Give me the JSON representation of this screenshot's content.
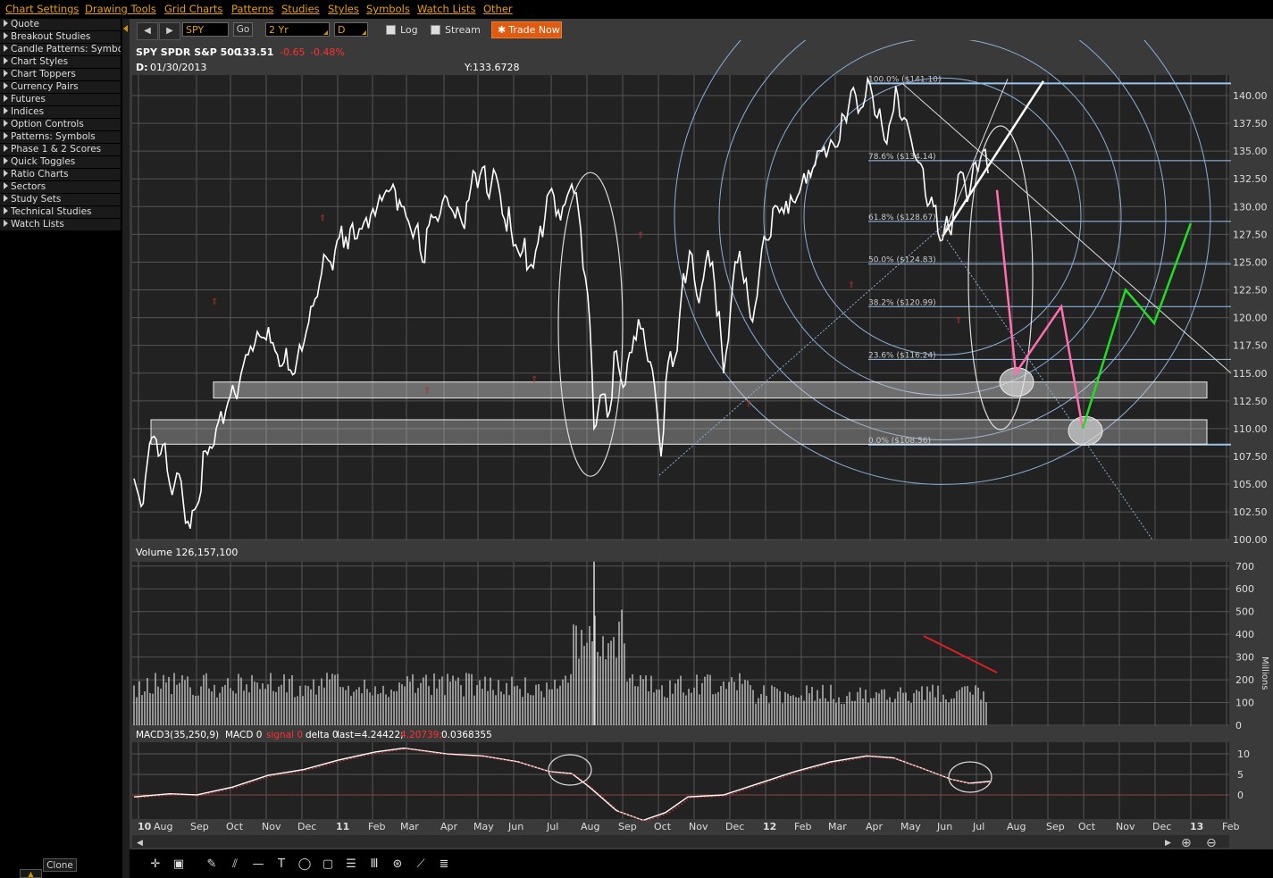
{
  "menu": [
    "Chart Settings",
    "Drawing Tools",
    "Grid Charts",
    "Patterns",
    "Studies",
    "Styles",
    "Symbols",
    "Watch Lists",
    "Other"
  ],
  "sidebar": [
    "Quote",
    "Breakout Studies",
    "Candle Patterns: Symbols",
    "Chart Styles",
    "Chart Toppers",
    "Currency Pairs",
    "Futures",
    "Indices",
    "Option Controls",
    "Patterns: Symbols",
    "Phase 1 & 2 Scores",
    "Quick Toggles",
    "Ratio Charts",
    "Sectors",
    "Study Sets",
    "Technical Studies",
    "Watch Lists"
  ],
  "toolbar": {
    "nav_back": "◀",
    "nav_fwd": "▶",
    "symbol": "SPY",
    "go": "Go",
    "period": "2 Yr",
    "interval": "D",
    "log": "Log",
    "stream": "Stream",
    "trade_now": "Trade Now"
  },
  "header": {
    "title": "SPY SPDR S&P 500",
    "price": "133.51",
    "change": "-0.65",
    "change_pct": "-0.48%",
    "date_label": "D:",
    "date": "01/30/2013",
    "y_label": "Y:133.6728"
  },
  "volume_header": "Volume 126,157,100",
  "macd_header": {
    "name": "MACD3(35,250,9)",
    "macd": "MACD 0",
    "signal": "signal 0",
    "delta": "delta 0",
    "last": "last=4.24422;",
    "last_red": "4.20739;",
    "last_val": "0.0368355"
  },
  "fib_labels": [
    "100.0% ($141.10)",
    "78.6% ($134.14)",
    "61.8% ($128.67)",
    "50.0% ($124.83)",
    "38.2% ($120.99)",
    "23.6% ($116.24)",
    "0.0% ($108.56)"
  ],
  "price_ticks": [
    "140.00",
    "137.50",
    "135.00",
    "132.50",
    "130.00",
    "127.50",
    "125.00",
    "122.50",
    "120.00",
    "117.50",
    "115.00",
    "112.50",
    "110.00",
    "107.50",
    "105.00",
    "102.50",
    "100.00"
  ],
  "volume_ticks": [
    "700",
    "600",
    "500",
    "400",
    "300",
    "200",
    "100",
    "0"
  ],
  "volume_unit": "Millions",
  "macd_ticks": [
    "10",
    "5",
    "0"
  ],
  "x_labels": [
    "10",
    "Aug",
    "Sep",
    "Oct",
    "Nov",
    "Dec",
    "11",
    "Feb",
    "Mar",
    "Apr",
    "May",
    "Jun",
    "Jul",
    "Aug",
    "Sep",
    "Oct",
    "Nov",
    "Dec",
    "12",
    "Feb",
    "Mar",
    "Apr",
    "May",
    "Jun",
    "Jul",
    "Aug",
    "Sep",
    "Oct",
    "Nov",
    "Dec",
    "13",
    "Feb"
  ],
  "bottom": {
    "clone": "Clone"
  },
  "colors": {
    "accent": "#e8a000",
    "trade": "#e05a10",
    "fib": "#9cc4ee",
    "down": "#ff3030",
    "projection_pink": "#ff6fb0",
    "projection_green": "#22dd22"
  },
  "chart_data": {
    "type": "line",
    "title": "SPY SPDR S&P 500",
    "ylim": [
      100,
      141.5
    ],
    "price_points": [
      [
        "2010-07",
        107
      ],
      [
        "2010-07",
        104
      ],
      [
        "2010-08",
        110
      ],
      [
        "2010-08",
        107.5
      ],
      [
        "2010-08",
        102
      ],
      [
        "2010-09",
        109
      ],
      [
        "2010-09",
        112
      ],
      [
        "2010-10",
        117
      ],
      [
        "2010-11",
        120
      ],
      [
        "2010-11",
        118
      ],
      [
        "2010-12",
        122
      ],
      [
        "2010-12",
        125
      ],
      [
        "2011-01",
        128
      ],
      [
        "2011-02",
        131
      ],
      [
        "2011-02",
        132
      ],
      [
        "2011-03",
        127
      ],
      [
        "2011-03",
        130
      ],
      [
        "2011-04",
        133
      ],
      [
        "2011-05",
        136
      ],
      [
        "2011-05",
        134
      ],
      [
        "2011-06",
        128
      ],
      [
        "2011-06",
        127
      ],
      [
        "2011-07",
        134
      ],
      [
        "2011-07",
        131
      ],
      [
        "2011-08",
        112
      ],
      [
        "2011-08",
        116
      ],
      [
        "2011-09",
        119
      ],
      [
        "2011-09",
        113
      ],
      [
        "2011-10",
        106
      ],
      [
        "2011-10",
        123
      ],
      [
        "2011-11",
        125
      ],
      [
        "2011-11",
        121
      ],
      [
        "2011-12",
        126
      ],
      [
        "2011-12",
        122
      ],
      [
        "2012-01",
        128
      ],
      [
        "2012-02",
        133
      ],
      [
        "2012-02",
        136
      ],
      [
        "2012-03",
        138
      ],
      [
        "2012-04",
        141
      ],
      [
        "2012-04",
        138
      ],
      [
        "2012-05",
        141
      ],
      [
        "2012-05",
        134
      ],
      [
        "2012-06",
        131
      ],
      [
        "2012-06",
        127
      ],
      [
        "2012-07",
        136
      ],
      [
        "2012-07",
        133.5
      ]
    ],
    "projection_pink": [
      [
        135,
        131
      ],
      [
        115,
        116
      ],
      [
        120,
        121
      ],
      [
        110,
        110
      ]
    ],
    "projection_green": [
      [
        110,
        110
      ],
      [
        122.5,
        122.5
      ],
      [
        119.5,
        119.5
      ],
      [
        128.5,
        128.5
      ]
    ],
    "volume_millions_peak": 720,
    "macd_range": [
      -2,
      13
    ]
  }
}
